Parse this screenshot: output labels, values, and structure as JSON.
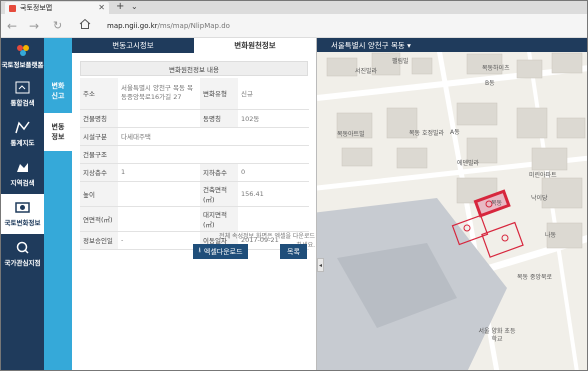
{
  "browser": {
    "tab_title": "국토정보맵",
    "url_host": "map.ngii.go.kr",
    "url_path": "/ms/map/NlipMap.do"
  },
  "leftnav": {
    "brand": "국토정보플랫폼",
    "items": [
      "통합검색",
      "통계지도",
      "지역검색",
      "국토변화정보",
      "국가관심지점"
    ]
  },
  "subnav": {
    "items": [
      [
        "변화",
        "신고"
      ],
      [
        "변동",
        "정보"
      ]
    ]
  },
  "panel": {
    "tabs": [
      "변동고시정보",
      "변화원천정보"
    ],
    "section_title": "변화원천정보 내용",
    "rows": [
      [
        "주소",
        "서울특별시 양천구 목동 목동중앙북로16가길 27",
        "변화유형",
        "신규"
      ],
      [
        "건물명칭",
        "",
        "동명칭",
        "102동"
      ],
      [
        "시설구분",
        "다세대주택",
        "",
        ""
      ],
      [
        "건물구조",
        "",
        "",
        ""
      ],
      [
        "지상층수",
        "1",
        "지하층수",
        "0"
      ],
      [
        "높이",
        "",
        "건축면적(㎡)",
        "156.41"
      ],
      [
        "연면적(㎡)",
        "",
        "대지면적(㎡)",
        ""
      ],
      [
        "정보승인일",
        "-",
        "이동일자",
        "2017-09-21"
      ]
    ],
    "note": "전체 속성정보 화면은 엑셀을 다운로드 하세요.",
    "download_button": "엑셀다운로드",
    "list_button": "목록"
  },
  "map": {
    "region": "서울특별시 양천구 목동 ▾",
    "labels": [
      "서진빌라",
      "팰림빌",
      "목동하이츠",
      "B동",
      "A동",
      "목동아트빌",
      "목동 호정빌라",
      "에덴빌라",
      "미린아파트",
      "낙이당",
      "나동",
      "목동",
      "목동 중앙북로",
      "서울 양화 초등학교"
    ]
  }
}
